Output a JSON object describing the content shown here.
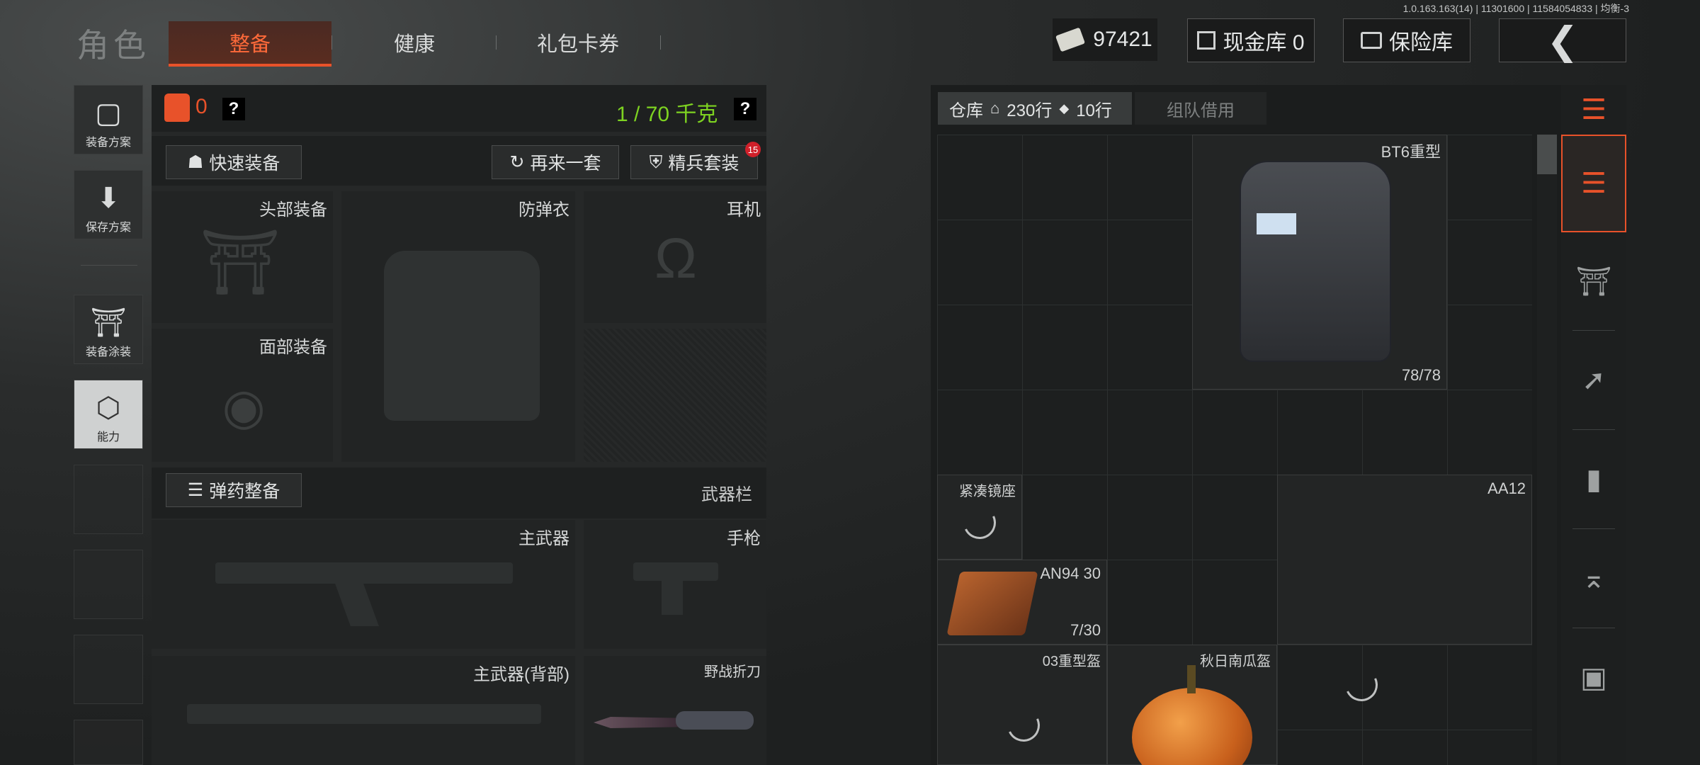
{
  "header": {
    "title": "角色",
    "tabs": [
      {
        "label": "整备",
        "active": true
      },
      {
        "label": "健康",
        "active": false
      },
      {
        "label": "礼包卡券",
        "active": false
      }
    ],
    "currency_value": "97421",
    "cash_vault_label": "现金库 0",
    "safe_box_label": "保险库",
    "version_text": "1.0.163.163(14) | 11301600 | 11584054833 | 均衡-3"
  },
  "sidebar": {
    "items": [
      {
        "label": "装备方案",
        "icon": "vest-icon"
      },
      {
        "label": "保存方案",
        "icon": "download-icon"
      },
      {
        "label": "装备涂装",
        "icon": "helmet-skin-icon"
      },
      {
        "label": "能力",
        "icon": "ability-icon"
      }
    ]
  },
  "equipment": {
    "armor_count": "0",
    "weight_text": "1 / 70 千克",
    "quick_equip_label": "快速装备",
    "again_label": "再来一套",
    "elite_set_label": "精兵套装",
    "elite_badge": "15",
    "slots": {
      "head": "头部装备",
      "vest": "防弹衣",
      "earphone": "耳机",
      "face": "面部装备",
      "primary": "主武器",
      "pistol": "手枪",
      "primary_back": "主武器(背部)",
      "knife": "野战折刀"
    },
    "ammo_label": "弹药整备",
    "weapon_bar_label": "武器栏"
  },
  "warehouse": {
    "tab_label": "仓库",
    "rows_label": "230行",
    "ticket_rows_label": "10行",
    "team_borrow_label": "组队借用",
    "items": [
      {
        "name": "BT6重型",
        "count": "78/78"
      },
      {
        "name": "紧凑镜座",
        "count": ""
      },
      {
        "name": "AA12",
        "count": ""
      },
      {
        "name": "AN94 30",
        "count": "7/30"
      },
      {
        "name": "03重型盔",
        "count": ""
      },
      {
        "name": "秋日南瓜盔",
        "count": ""
      }
    ]
  },
  "colors": {
    "accent": "#e8522a",
    "weight_green": "#7ed321",
    "badge_red": "#d0202a"
  }
}
